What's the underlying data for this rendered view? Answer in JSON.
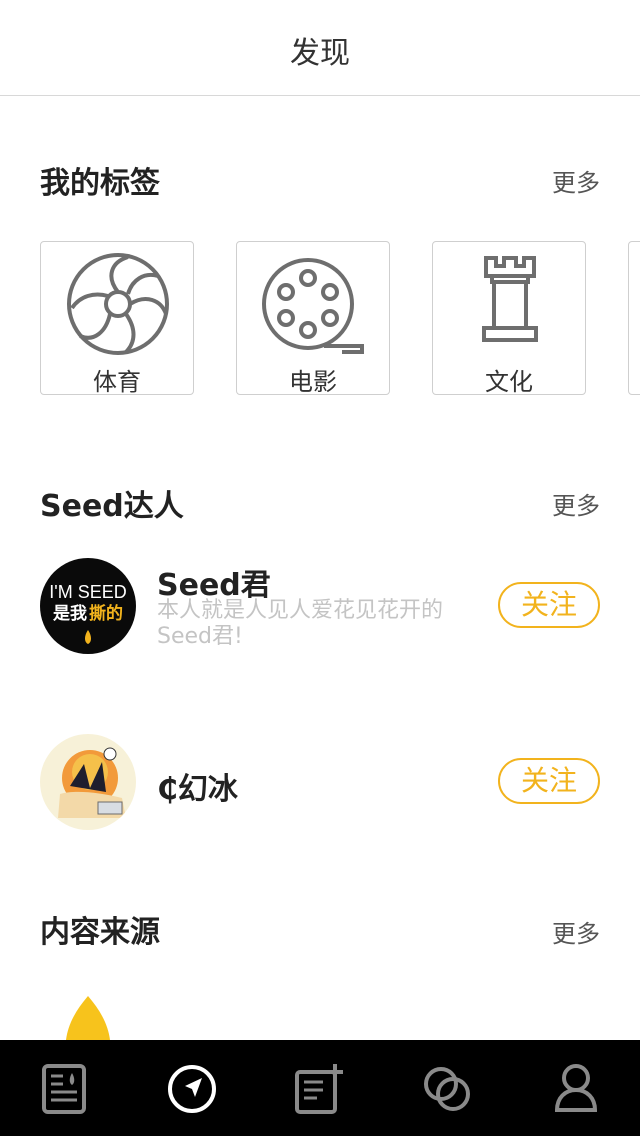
{
  "header": {
    "title": "发现"
  },
  "tags_section": {
    "title": "我的标签",
    "more": "更多",
    "items": [
      {
        "label": "体育",
        "icon": "volleyball-icon"
      },
      {
        "label": "电影",
        "icon": "film-reel-icon"
      },
      {
        "label": "文化",
        "icon": "chess-rook-icon"
      }
    ]
  },
  "experts_section": {
    "title": "Seed达人",
    "more": "更多",
    "items": [
      {
        "name": "Seed君",
        "desc": "本人就是人见人爱花见花开的Seed君!",
        "follow": "关注",
        "avatar_text_1": "I'M SEED",
        "avatar_text_2": "是我",
        "avatar_text_3": "撕的"
      },
      {
        "name": "₵幻冰",
        "desc": "",
        "follow": "关注"
      }
    ]
  },
  "sources_section": {
    "title": "内容来源",
    "more": "更多"
  },
  "tabbar": {
    "items": [
      {
        "icon": "news-icon"
      },
      {
        "icon": "discover-compass-icon",
        "active": true
      },
      {
        "icon": "compose-icon"
      },
      {
        "icon": "circles-icon"
      },
      {
        "icon": "profile-icon"
      }
    ]
  },
  "colors": {
    "accent": "#f2b31d",
    "tabbar_bg": "#000000",
    "tab_icon": "#8a8a8a",
    "tab_icon_active": "#ffffff"
  }
}
